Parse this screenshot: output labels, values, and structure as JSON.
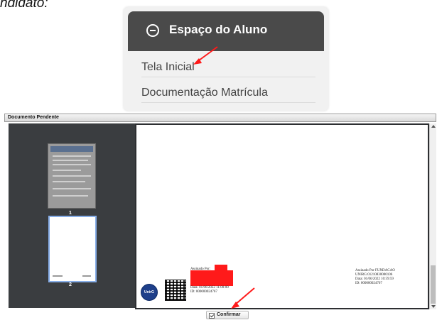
{
  "caption": {
    "text": "ndidato:"
  },
  "menu": {
    "title": "Espaço do Aluno",
    "items": [
      {
        "label": "Tela Inicial"
      },
      {
        "label": "Documentação Matrícula"
      }
    ]
  },
  "viewer": {
    "window_title": "Documento Pendente",
    "thumbnails": [
      {
        "page_number": "1"
      },
      {
        "page_number": "2"
      }
    ],
    "signatures": {
      "left": {
        "assinado_por": "Assinado Por:",
        "data": "Data: 01/06/2022 11:00:00",
        "id": "ID: 000000024767"
      },
      "right": {
        "assinado_por": "Assinado Por FUNDACAO",
        "org_id": "UNIRG:01210830000106",
        "data": "Data: 01/06/2022 10:59:59",
        "id": "ID: 000000024767"
      }
    },
    "seal_label": "UnirG",
    "confirm_label": "Confirmar"
  },
  "colors": {
    "menu_header": "#4a4a4a",
    "thumb_panel": "#3a3d40",
    "selected_thumb_border": "#87aee8",
    "annotation_arrow": "#ff1a1a"
  }
}
